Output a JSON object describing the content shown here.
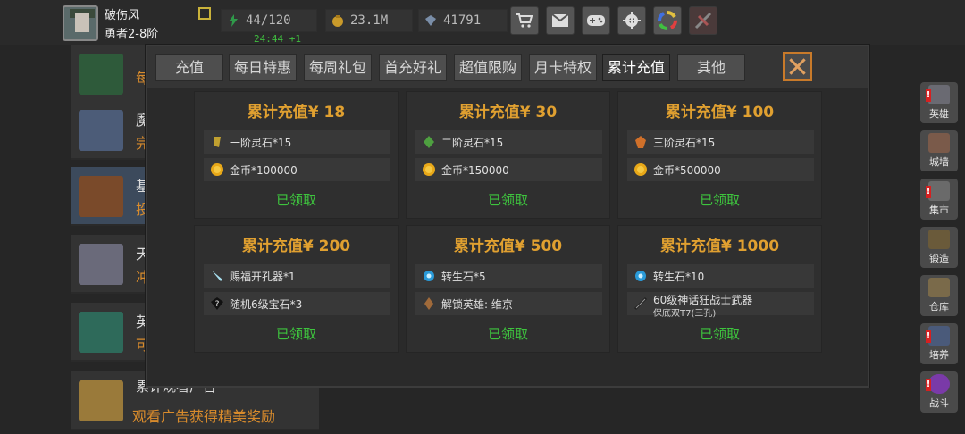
{
  "player": {
    "name": "破伤风",
    "rank": "勇者2-8阶"
  },
  "resources": {
    "energy": "44/120",
    "energy_timer": "24:44 +1",
    "gold": "23.1M",
    "gems": "41791"
  },
  "top_buttons": [
    "shop-cart-icon",
    "mail-icon",
    "gamepad-icon",
    "gear-icon",
    "color-wheel-icon",
    "event-icon"
  ],
  "left_list": [
    {
      "title": "",
      "subtitle": "每"
    },
    {
      "title": "魔",
      "subtitle": "完"
    },
    {
      "title": "基",
      "subtitle": "投"
    },
    {
      "title": "天",
      "subtitle": "冲"
    },
    {
      "title": "英",
      "subtitle": "可"
    },
    {
      "title": "累计观看广告",
      "subtitle": "观看广告获得精美奖励"
    }
  ],
  "side_nav": [
    {
      "label": "英雄",
      "alert": "!"
    },
    {
      "label": "城墙",
      "alert": ""
    },
    {
      "label": "集市",
      "alert": "!"
    },
    {
      "label": "锻造",
      "alert": ""
    },
    {
      "label": "仓库",
      "alert": ""
    },
    {
      "label": "培养",
      "alert": "!"
    },
    {
      "label": "战斗",
      "alert": "!"
    }
  ],
  "tabs": [
    "充值",
    "每日特惠",
    "每周礼包",
    "首充好礼",
    "超值限购",
    "月卡特权",
    "累计充值",
    "其他"
  ],
  "active_tab": "累计充值",
  "cards": [
    {
      "title": "累计充值¥ 18",
      "status": "已领取",
      "rewards": [
        {
          "icon": "tier1-spirit-stone-icon",
          "text": "一阶灵石*15"
        },
        {
          "icon": "gold-coin-icon",
          "text": "金币*100000"
        }
      ]
    },
    {
      "title": "累计充值¥ 30",
      "status": "已领取",
      "rewards": [
        {
          "icon": "tier2-spirit-stone-icon",
          "text": "二阶灵石*15"
        },
        {
          "icon": "gold-coin-icon",
          "text": "金币*150000"
        }
      ]
    },
    {
      "title": "累计充值¥ 100",
      "status": "已领取",
      "rewards": [
        {
          "icon": "tier3-spirit-stone-icon",
          "text": "三阶灵石*15"
        },
        {
          "icon": "gold-coin-icon",
          "text": "金币*500000"
        }
      ]
    },
    {
      "title": "累计充值¥ 200",
      "status": "已领取",
      "rewards": [
        {
          "icon": "drill-icon",
          "text": "赐福开孔器*1"
        },
        {
          "icon": "random-gem-icon",
          "text": "随机6级宝石*3"
        }
      ]
    },
    {
      "title": "累计充值¥ 500",
      "status": "已领取",
      "rewards": [
        {
          "icon": "rebirth-stone-icon",
          "text": "转生石*5"
        },
        {
          "icon": "hero-unlock-icon",
          "text": "解锁英雄: 维京"
        }
      ]
    },
    {
      "title": "累计充值¥ 1000",
      "status": "已领取",
      "rewards": [
        {
          "icon": "rebirth-stone-icon",
          "text": "转生石*10"
        },
        {
          "icon": "weapon-icon",
          "text": "60级神话狂战士武器",
          "subtext": "保底双T7(三孔)"
        }
      ]
    }
  ]
}
